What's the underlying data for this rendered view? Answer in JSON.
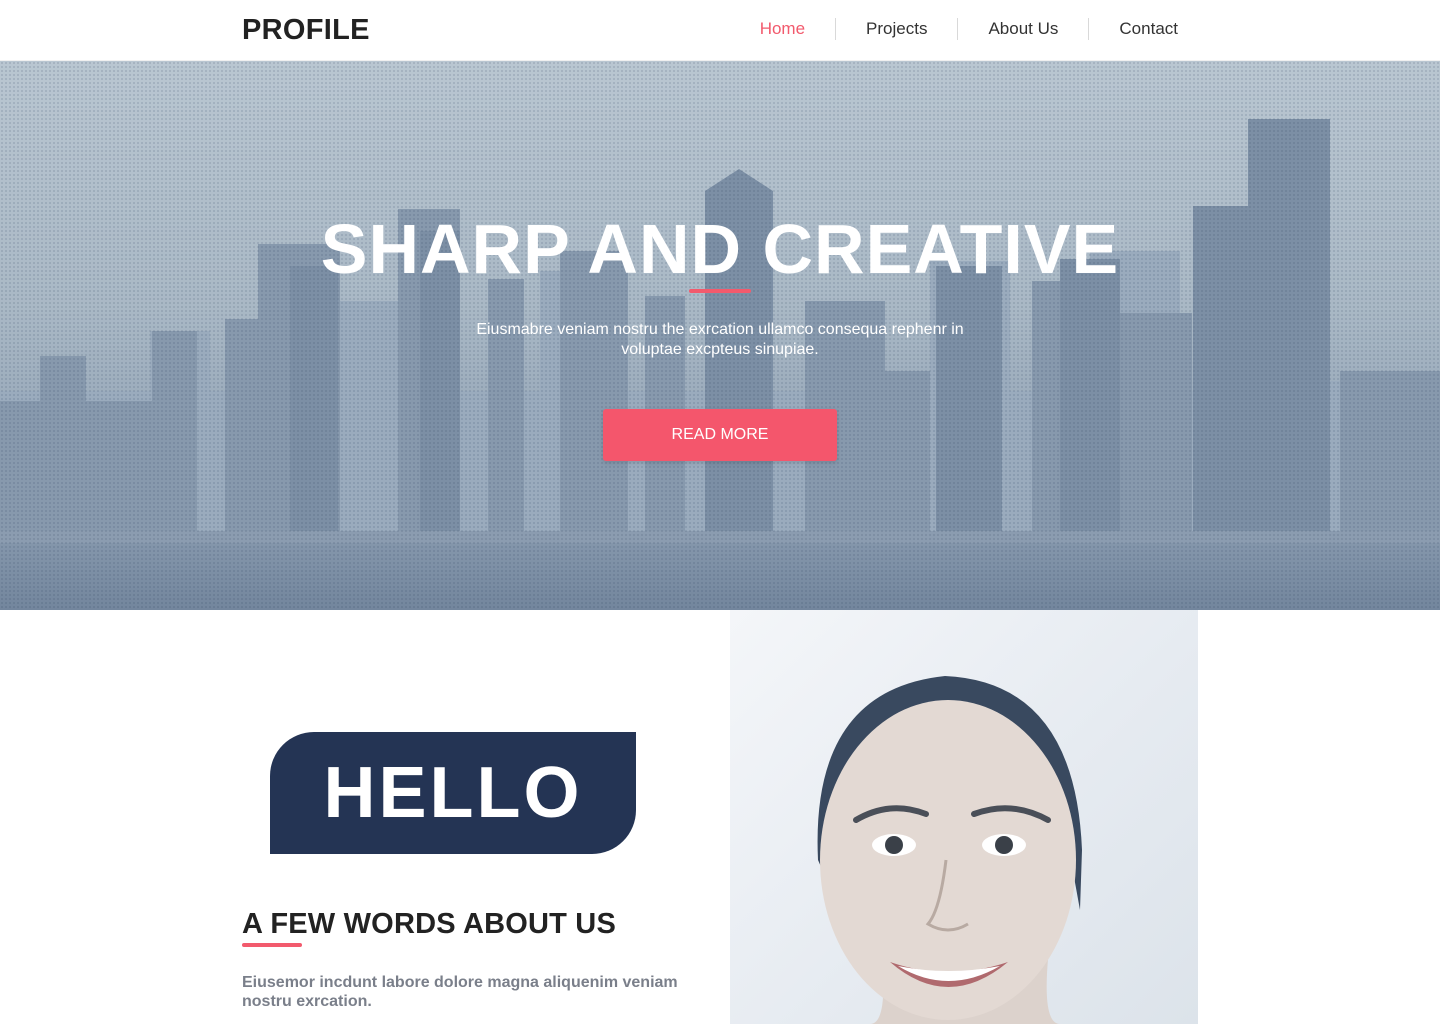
{
  "header": {
    "logo": "PROFILE",
    "nav": [
      {
        "label": "Home",
        "active": true
      },
      {
        "label": "Projects",
        "active": false
      },
      {
        "label": "About Us",
        "active": false
      },
      {
        "label": "Contact",
        "active": false
      }
    ]
  },
  "hero": {
    "title": "SHARP AND CREATIVE",
    "subtitle": "Eiusmabre veniam nostru the exrcation ullamco consequa rephenr in voluptae excpteus sinupiae.",
    "button_label": "READ MORE"
  },
  "about": {
    "hello": "HELLO",
    "heading": "A FEW WORDS ABOUT US",
    "text": "Eiusemor incdunt labore dolore magna aliquenim veniam nostru exrcation."
  },
  "colors": {
    "accent": "#f25a6d",
    "navy": "#243454",
    "text_dark": "#222222",
    "text_muted": "#7a7f8a"
  }
}
